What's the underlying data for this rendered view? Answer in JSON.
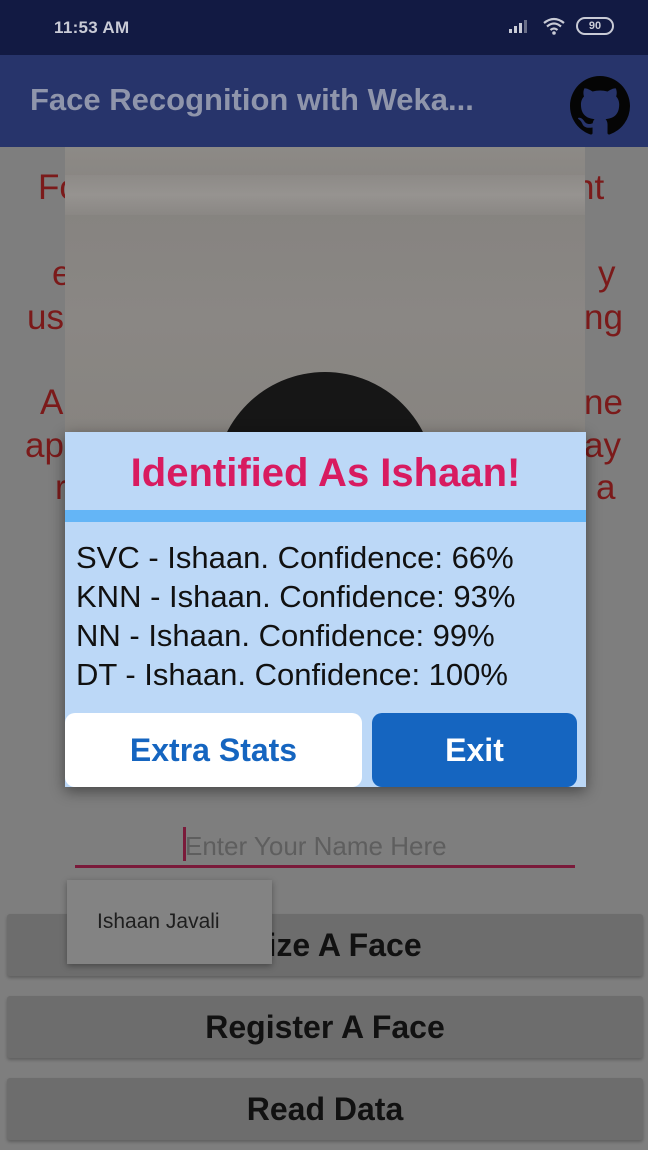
{
  "status_bar": {
    "time": "11:53 AM",
    "battery": "90",
    "icons": [
      "signal-icon",
      "wifi-icon",
      "battery-icon"
    ]
  },
  "app_bar": {
    "title": "Face Recognition with Weka...",
    "action_icon": "github-icon"
  },
  "background": {
    "description_fragments": [
      {
        "left": "Fo",
        "right": "nt"
      },
      {
        "left": "e",
        "right": "y"
      },
      {
        "left": "us",
        "right": "ng"
      },
      {
        "left": "A",
        "right": "ne"
      },
      {
        "left": "ap",
        "right": "ay"
      },
      {
        "left": "r",
        "right": "a"
      }
    ],
    "name_input": {
      "placeholder": "Enter Your Name Here",
      "value": ""
    },
    "autocomplete_suggestion": "Ishaan Javali",
    "buttons": {
      "recognize": "gnize A Face",
      "register": "Register A Face",
      "read": "Read Data"
    }
  },
  "dialog": {
    "title": "Identified As Ishaan!",
    "results": [
      "SVC - Ishaan. Confidence: 66%",
      "KNN - Ishaan. Confidence: 93%",
      "NN - Ishaan. Confidence: 99%",
      "DT - Ishaan. Confidence: 100%"
    ],
    "extra_stats_label": "Extra Stats",
    "exit_label": "Exit"
  },
  "colors": {
    "status_bar": "#121a43",
    "app_bar": "#27346b",
    "dialog_bg": "#bcd8f7",
    "dialog_title": "#d81b60",
    "divider": "#64b5f6",
    "primary_button": "#1565c0"
  }
}
